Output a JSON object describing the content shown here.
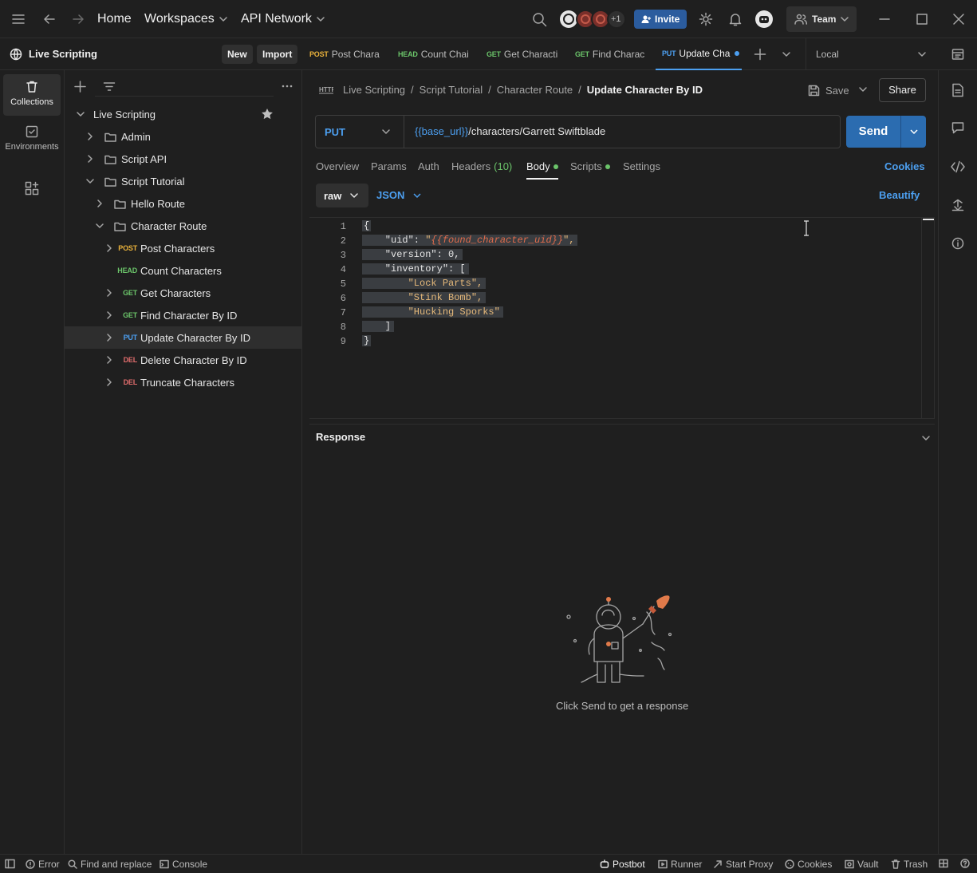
{
  "topbar": {
    "home": "Home",
    "workspaces": "Workspaces",
    "api_network": "API Network",
    "avatars_more": "+1",
    "invite": "Invite",
    "team": "Team"
  },
  "workspace": {
    "name": "Live Scripting",
    "new": "New",
    "import": "Import"
  },
  "tabs": [
    {
      "method": "POST",
      "label": "Post Chara"
    },
    {
      "method": "HEAD",
      "label": "Count Chai"
    },
    {
      "method": "GET",
      "label": "Get Characti"
    },
    {
      "method": "GET",
      "label": "Find Charac"
    },
    {
      "method": "PUT",
      "label": "Update Cha"
    }
  ],
  "environment": "Local",
  "rail": {
    "collections": "Collections",
    "environments": "Environments"
  },
  "tree": {
    "root": "Live Scripting",
    "admin": "Admin",
    "script_api": "Script API",
    "script_tutorial": "Script Tutorial",
    "hello_route": "Hello Route",
    "character_route": "Character Route",
    "requests": [
      {
        "method": "POST",
        "label": "Post Characters"
      },
      {
        "method": "HEAD",
        "label": "Count Characters"
      },
      {
        "method": "GET",
        "label": "Get Characters"
      },
      {
        "method": "GET",
        "label": "Find Character By ID"
      },
      {
        "method": "PUT",
        "label": "Update Character By ID"
      },
      {
        "method": "DEL",
        "label": "Delete Character By ID"
      },
      {
        "method": "DEL",
        "label": "Truncate Characters"
      }
    ]
  },
  "breadcrumb": {
    "items": [
      "Live Scripting",
      "Script Tutorial",
      "Character Route"
    ],
    "current": "Update Character By ID",
    "sep": "/"
  },
  "request": {
    "save": "Save",
    "share": "Share",
    "method": "PUT",
    "url_var": "{{base_url}}",
    "url_path": "/characters/Garrett Swiftblade",
    "send": "Send"
  },
  "subtabs": {
    "overview": "Overview",
    "params": "Params",
    "auth": "Auth",
    "headers": "Headers",
    "headers_count": "(10)",
    "body": "Body",
    "scripts": "Scripts",
    "settings": "Settings",
    "cookies": "Cookies"
  },
  "body_mode": {
    "raw": "raw",
    "json": "JSON",
    "beautify": "Beautify"
  },
  "editor": {
    "line_numbers": [
      "1",
      "2",
      "3",
      "4",
      "5",
      "6",
      "7",
      "8",
      "9"
    ],
    "l1": "{",
    "l2_key": "    \"uid\": ",
    "l2_q1": "\"",
    "l2_var": "{{found_character_uid}}",
    "l2_q2": "\",",
    "l3": "    \"version\": 0,",
    "l4": "    \"inventory\": [",
    "l5": "\"Lock Parts\",",
    "l6": "\"Stink Bomb\",",
    "l7": "\"Hucking Sporks\"",
    "l8": "    ]",
    "l9": "}"
  },
  "response": {
    "title": "Response",
    "empty": "Click Send to get a response"
  },
  "status": {
    "error": "Error",
    "find": "Find and replace",
    "console": "Console",
    "postbot": "Postbot",
    "runner": "Runner",
    "proxy": "Start Proxy",
    "cookies": "Cookies",
    "vault": "Vault",
    "trash": "Trash"
  }
}
